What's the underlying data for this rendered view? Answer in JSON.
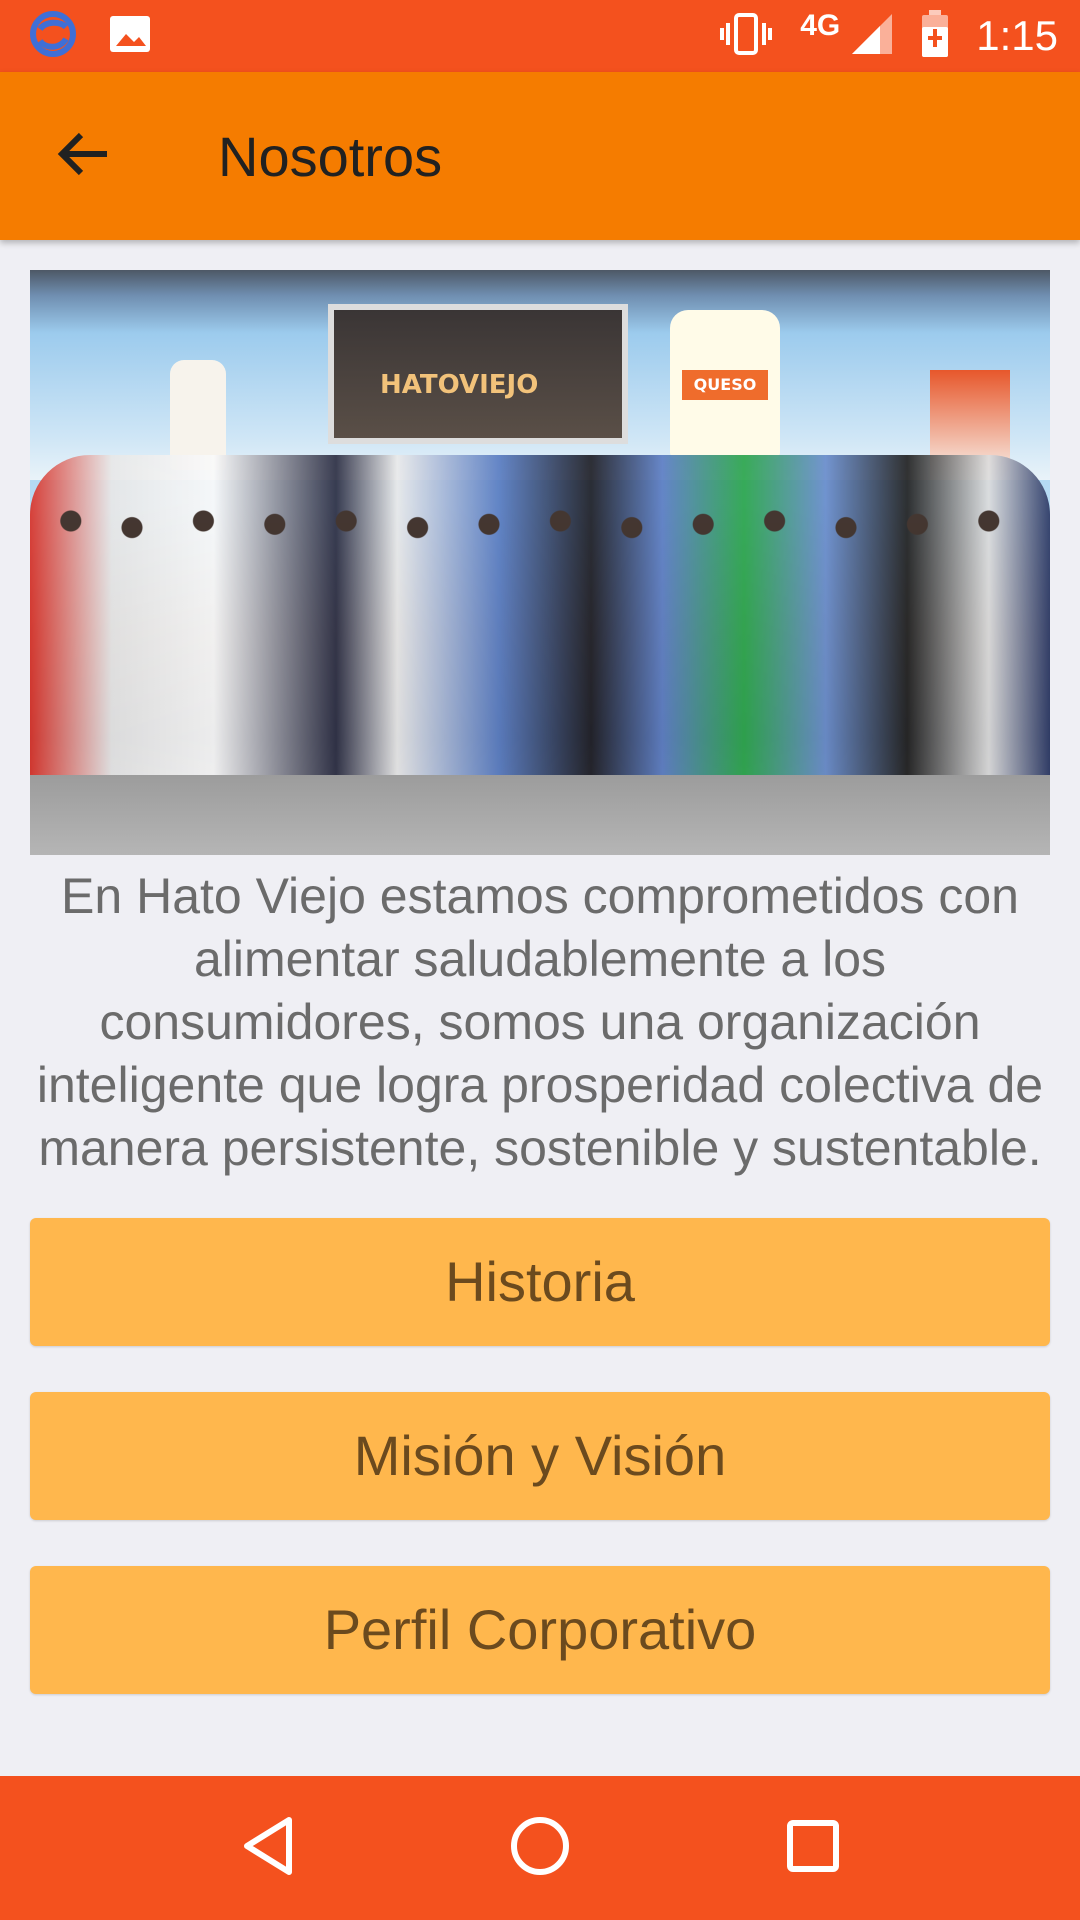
{
  "status_bar": {
    "network_label": "4G",
    "time": "1:15",
    "icons": [
      "sync-app-icon",
      "gallery-icon",
      "vibrate-icon",
      "signal-icon",
      "battery-charging-icon"
    ]
  },
  "app_bar": {
    "title": "Nosotros",
    "back_icon": "arrow-back-icon"
  },
  "hero": {
    "brand_text": "HATOVIEJO",
    "jug_label": "QUESO"
  },
  "description": "En Hato Viejo estamos comprometidos con alimentar saludablemente a los consumidores, somos una organización inteligente que logra prosperidad colectiva de manera persistente, sostenible y sustentable.",
  "buttons": {
    "historia": "Historia",
    "mision": "Misión y Visión",
    "perfil": "Perfil Corporativo"
  },
  "colors": {
    "status_bar": "#f4511e",
    "app_bar": "#f57c00",
    "button": "#ffb74d",
    "background": "#efeff4"
  },
  "nav_bar": {
    "icons": [
      "back-triangle-icon",
      "home-circle-icon",
      "recents-square-icon"
    ]
  }
}
